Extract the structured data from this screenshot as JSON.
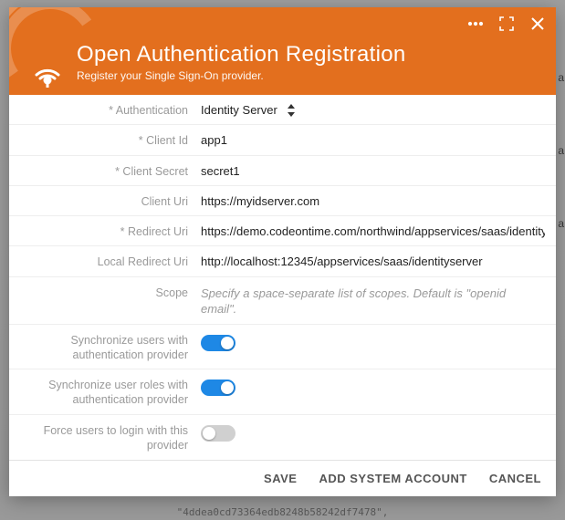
{
  "header": {
    "title": "Open Authentication Registration",
    "subtitle": "Register your Single Sign-On provider."
  },
  "fields": {
    "authentication": {
      "label": "* Authentication",
      "value": "Identity Server"
    },
    "client_id": {
      "label": "* Client Id",
      "value": "app1"
    },
    "client_secret": {
      "label": "* Client Secret",
      "value": "secret1"
    },
    "client_uri": {
      "label": "Client Uri",
      "value": "https://myidserver.com"
    },
    "redirect_uri": {
      "label": "* Redirect Uri",
      "value": "https://demo.codeontime.com/northwind/appservices/saas/identity"
    },
    "local_redirect": {
      "label": "Local Redirect Uri",
      "value": "http://localhost:12345/appservices/saas/identityserver"
    },
    "scope": {
      "label": "Scope",
      "placeholder": "Specify a space-separate list of scopes. Default is \"openid email\"."
    },
    "sync_users": {
      "label": "Synchronize users with authentication provider",
      "on": true
    },
    "sync_roles": {
      "label": "Synchronize user roles with authentication provider",
      "on": true
    },
    "force_login": {
      "label": "Force users to login with this provider",
      "on": false
    }
  },
  "footer": {
    "save": "SAVE",
    "add_system_account": "ADD SYSTEM ACCOUNT",
    "cancel": "CANCEL"
  },
  "backdrop_hash": "4ddea0cd73364edb8248b58242df7478"
}
